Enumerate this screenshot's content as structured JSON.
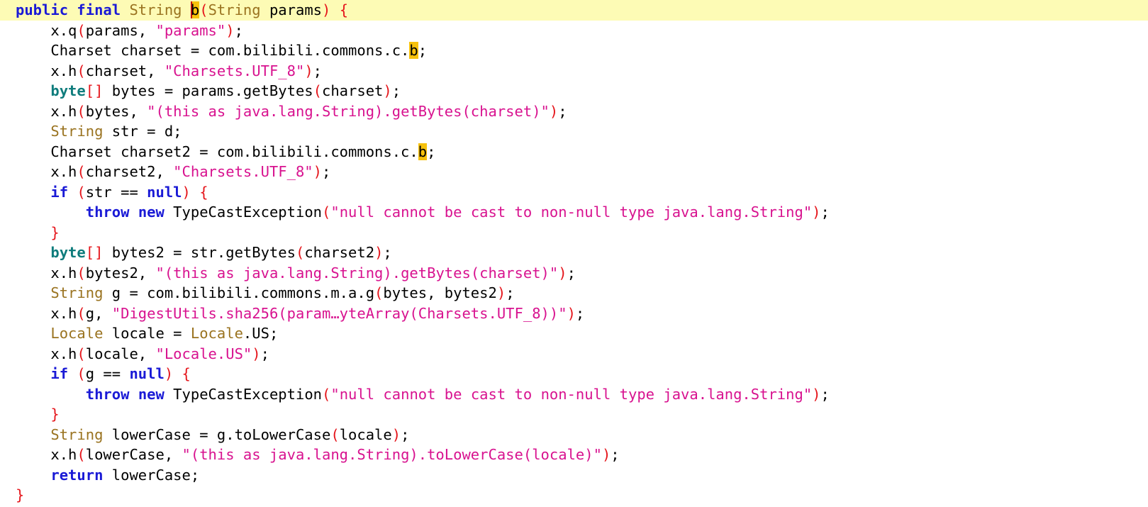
{
  "editor": {
    "indent_unit": "    ",
    "current_line": 0,
    "lines": [
      {
        "indent": 0,
        "tokens": [
          {
            "t": "public",
            "k": "kw"
          },
          {
            "t": " ",
            "k": "plain"
          },
          {
            "t": "final",
            "k": "kw"
          },
          {
            "t": " ",
            "k": "plain"
          },
          {
            "t": "String",
            "k": "type"
          },
          {
            "t": " ",
            "k": "plain"
          },
          {
            "t": "b",
            "k": "caret"
          },
          {
            "t": "(",
            "k": "br"
          },
          {
            "t": "String",
            "k": "type"
          },
          {
            "t": " params",
            "k": "plain"
          },
          {
            "t": ") {",
            "k": "br"
          }
        ]
      },
      {
        "indent": 1,
        "tokens": [
          {
            "t": "x.q",
            "k": "plain"
          },
          {
            "t": "(",
            "k": "br"
          },
          {
            "t": "params, ",
            "k": "plain"
          },
          {
            "t": "\"params\"",
            "k": "str"
          },
          {
            "t": ")",
            "k": "br"
          },
          {
            "t": ";",
            "k": "plain"
          }
        ]
      },
      {
        "indent": 1,
        "tokens": [
          {
            "t": "Charset charset = com.bilibili.commons.c.",
            "k": "plain"
          },
          {
            "t": "b",
            "k": "hl"
          },
          {
            "t": ";",
            "k": "plain"
          }
        ]
      },
      {
        "indent": 1,
        "tokens": [
          {
            "t": "x.h",
            "k": "plain"
          },
          {
            "t": "(",
            "k": "br"
          },
          {
            "t": "charset, ",
            "k": "plain"
          },
          {
            "t": "\"Charsets.UTF_8\"",
            "k": "str"
          },
          {
            "t": ")",
            "k": "br"
          },
          {
            "t": ";",
            "k": "plain"
          }
        ]
      },
      {
        "indent": 1,
        "tokens": [
          {
            "t": "byte",
            "k": "kw2"
          },
          {
            "t": "[]",
            "k": "br"
          },
          {
            "t": " bytes = params.getBytes",
            "k": "plain"
          },
          {
            "t": "(",
            "k": "br"
          },
          {
            "t": "charset",
            "k": "plain"
          },
          {
            "t": ")",
            "k": "br"
          },
          {
            "t": ";",
            "k": "plain"
          }
        ]
      },
      {
        "indent": 1,
        "tokens": [
          {
            "t": "x.h",
            "k": "plain"
          },
          {
            "t": "(",
            "k": "br"
          },
          {
            "t": "bytes, ",
            "k": "plain"
          },
          {
            "t": "\"(this as java.lang.String).getBytes(charset)\"",
            "k": "str"
          },
          {
            "t": ")",
            "k": "br"
          },
          {
            "t": ";",
            "k": "plain"
          }
        ]
      },
      {
        "indent": 1,
        "tokens": [
          {
            "t": "String",
            "k": "type"
          },
          {
            "t": " str = d;",
            "k": "plain"
          }
        ]
      },
      {
        "indent": 1,
        "tokens": [
          {
            "t": "Charset charset2 = com.bilibili.commons.c.",
            "k": "plain"
          },
          {
            "t": "b",
            "k": "hl"
          },
          {
            "t": ";",
            "k": "plain"
          }
        ]
      },
      {
        "indent": 1,
        "tokens": [
          {
            "t": "x.h",
            "k": "plain"
          },
          {
            "t": "(",
            "k": "br"
          },
          {
            "t": "charset2, ",
            "k": "plain"
          },
          {
            "t": "\"Charsets.UTF_8\"",
            "k": "str"
          },
          {
            "t": ")",
            "k": "br"
          },
          {
            "t": ";",
            "k": "plain"
          }
        ]
      },
      {
        "indent": 1,
        "tokens": [
          {
            "t": "if",
            "k": "kw"
          },
          {
            "t": " ",
            "k": "plain"
          },
          {
            "t": "(",
            "k": "br"
          },
          {
            "t": "str == ",
            "k": "plain"
          },
          {
            "t": "null",
            "k": "kw"
          },
          {
            "t": ")",
            "k": "br"
          },
          {
            "t": " ",
            "k": "plain"
          },
          {
            "t": "{",
            "k": "br"
          }
        ]
      },
      {
        "indent": 2,
        "tokens": [
          {
            "t": "throw",
            "k": "kw"
          },
          {
            "t": " ",
            "k": "plain"
          },
          {
            "t": "new",
            "k": "kw"
          },
          {
            "t": " TypeCastException",
            "k": "plain"
          },
          {
            "t": "(",
            "k": "br"
          },
          {
            "t": "\"null cannot be cast to non-null type java.lang.String\"",
            "k": "str"
          },
          {
            "t": ")",
            "k": "br"
          },
          {
            "t": ";",
            "k": "plain"
          }
        ]
      },
      {
        "indent": 1,
        "tokens": [
          {
            "t": "}",
            "k": "br"
          }
        ]
      },
      {
        "indent": 1,
        "tokens": [
          {
            "t": "byte",
            "k": "kw2"
          },
          {
            "t": "[]",
            "k": "br"
          },
          {
            "t": " bytes2 = str.getBytes",
            "k": "plain"
          },
          {
            "t": "(",
            "k": "br"
          },
          {
            "t": "charset2",
            "k": "plain"
          },
          {
            "t": ")",
            "k": "br"
          },
          {
            "t": ";",
            "k": "plain"
          }
        ]
      },
      {
        "indent": 1,
        "tokens": [
          {
            "t": "x.h",
            "k": "plain"
          },
          {
            "t": "(",
            "k": "br"
          },
          {
            "t": "bytes2, ",
            "k": "plain"
          },
          {
            "t": "\"(this as java.lang.String).getBytes(charset)\"",
            "k": "str"
          },
          {
            "t": ")",
            "k": "br"
          },
          {
            "t": ";",
            "k": "plain"
          }
        ]
      },
      {
        "indent": 1,
        "tokens": [
          {
            "t": "String",
            "k": "type"
          },
          {
            "t": " g = com.bilibili.commons.m.a.g",
            "k": "plain"
          },
          {
            "t": "(",
            "k": "br"
          },
          {
            "t": "bytes, bytes2",
            "k": "plain"
          },
          {
            "t": ")",
            "k": "br"
          },
          {
            "t": ";",
            "k": "plain"
          }
        ]
      },
      {
        "indent": 1,
        "tokens": [
          {
            "t": "x.h",
            "k": "plain"
          },
          {
            "t": "(",
            "k": "br"
          },
          {
            "t": "g, ",
            "k": "plain"
          },
          {
            "t": "\"DigestUtils.sha256(param…yteArray(Charsets.UTF_8))\"",
            "k": "str"
          },
          {
            "t": ")",
            "k": "br"
          },
          {
            "t": ";",
            "k": "plain"
          }
        ]
      },
      {
        "indent": 1,
        "tokens": [
          {
            "t": "Locale",
            "k": "type"
          },
          {
            "t": " locale = ",
            "k": "plain"
          },
          {
            "t": "Locale",
            "k": "type"
          },
          {
            "t": ".US;",
            "k": "plain"
          }
        ]
      },
      {
        "indent": 1,
        "tokens": [
          {
            "t": "x.h",
            "k": "plain"
          },
          {
            "t": "(",
            "k": "br"
          },
          {
            "t": "locale, ",
            "k": "plain"
          },
          {
            "t": "\"Locale.US\"",
            "k": "str"
          },
          {
            "t": ")",
            "k": "br"
          },
          {
            "t": ";",
            "k": "plain"
          }
        ]
      },
      {
        "indent": 1,
        "tokens": [
          {
            "t": "if",
            "k": "kw"
          },
          {
            "t": " ",
            "k": "plain"
          },
          {
            "t": "(",
            "k": "br"
          },
          {
            "t": "g == ",
            "k": "plain"
          },
          {
            "t": "null",
            "k": "kw"
          },
          {
            "t": ")",
            "k": "br"
          },
          {
            "t": " ",
            "k": "plain"
          },
          {
            "t": "{",
            "k": "br"
          }
        ]
      },
      {
        "indent": 2,
        "tokens": [
          {
            "t": "throw",
            "k": "kw"
          },
          {
            "t": " ",
            "k": "plain"
          },
          {
            "t": "new",
            "k": "kw"
          },
          {
            "t": " TypeCastException",
            "k": "plain"
          },
          {
            "t": "(",
            "k": "br"
          },
          {
            "t": "\"null cannot be cast to non-null type java.lang.String\"",
            "k": "str"
          },
          {
            "t": ")",
            "k": "br"
          },
          {
            "t": ";",
            "k": "plain"
          }
        ]
      },
      {
        "indent": 1,
        "tokens": [
          {
            "t": "}",
            "k": "br"
          }
        ]
      },
      {
        "indent": 1,
        "tokens": [
          {
            "t": "String",
            "k": "type"
          },
          {
            "t": " lowerCase = g.toLowerCase",
            "k": "plain"
          },
          {
            "t": "(",
            "k": "br"
          },
          {
            "t": "locale",
            "k": "plain"
          },
          {
            "t": ")",
            "k": "br"
          },
          {
            "t": ";",
            "k": "plain"
          }
        ]
      },
      {
        "indent": 1,
        "tokens": [
          {
            "t": "x.h",
            "k": "plain"
          },
          {
            "t": "(",
            "k": "br"
          },
          {
            "t": "lowerCase, ",
            "k": "plain"
          },
          {
            "t": "\"(this as java.lang.String).toLowerCase(locale)\"",
            "k": "str"
          },
          {
            "t": ")",
            "k": "br"
          },
          {
            "t": ";",
            "k": "plain"
          }
        ]
      },
      {
        "indent": 1,
        "tokens": [
          {
            "t": "return",
            "k": "kw"
          },
          {
            "t": " lowerCase;",
            "k": "plain"
          }
        ]
      },
      {
        "indent": 0,
        "tokens": [
          {
            "t": "}",
            "k": "br"
          }
        ]
      }
    ]
  },
  "colors": {
    "keyword": "#1a1ad6",
    "primitive": "#0f7c7c",
    "type": "#9a7320",
    "string": "#d8128f",
    "bracket": "#e5151b",
    "highlight": "#f6c10c",
    "current_line_bg": "#fdfbb5"
  }
}
